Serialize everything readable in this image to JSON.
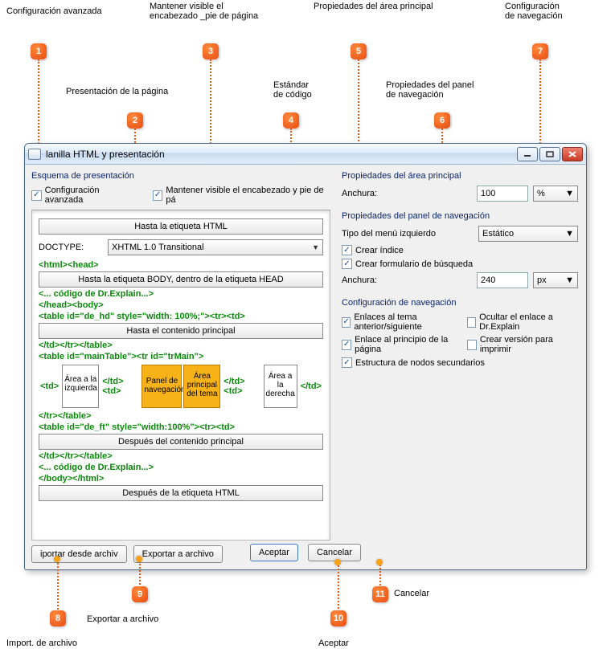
{
  "callouts": {
    "c1": {
      "num": "1",
      "label": "Configuración avanzada"
    },
    "c2": {
      "num": "2",
      "label": "Presentación de la página"
    },
    "c3": {
      "num": "3",
      "label": "Mantener visible el\nencabezado _pie de página"
    },
    "c4": {
      "num": "4",
      "label": "Estándar\nde código"
    },
    "c5": {
      "num": "5",
      "label": "Propiedades del área\nprincipal"
    },
    "c6": {
      "num": "6",
      "label": "Propiedades del panel\nde navegación"
    },
    "c7": {
      "num": "7",
      "label": "Configuración\nde navegación"
    },
    "c8": {
      "num": "8",
      "label": "Import. de archivo"
    },
    "c9": {
      "num": "9",
      "label": "Exportar a archivo"
    },
    "c10": {
      "num": "10",
      "label": "Aceptar"
    },
    "c11": {
      "num": "11",
      "label": "Cancelar"
    }
  },
  "window": {
    "title": "lanilla HTML y presentación"
  },
  "left": {
    "section_title": "Esquema de presentación",
    "chk_advanced": "Configuración avanzada",
    "chk_keep_header": "Mantener visible el encabezado y pie de pá",
    "slot_before_html": "Hasta la etiqueta HTML",
    "doctype_label": "DOCTYPE:",
    "doctype_value": "XHTML 1.0 Transitional",
    "code_html_head": "<html><head>",
    "slot_in_head": "Hasta la etiqueta BODY, dentro de la etiqueta HEAD",
    "code_dr_head": "<... código de Dr.Explain...>",
    "code_head_body": "</head><body>",
    "code_table_hd": "<table id=\"de_hd\" style=\"width: 100%;\"><tr><td>",
    "slot_before_main": "Hasta el contenido principal",
    "code_close_hd": "</td></tr></table>",
    "code_main_table": "<table id=\"mainTable\"><tr id=\"trMain\">",
    "cell_left": "Área a la\nizquierda",
    "cell_nav": "Panel de\nnavegación",
    "cell_main": "Área\nprincipal\ndel tema",
    "cell_right": "Área a\nla\nderecha",
    "tag_td_open": "<td>",
    "tag_td_close": "</td>",
    "tag_tdtd": "</td><td>",
    "code_close_main": "</tr></table>",
    "code_table_ft": "<table id=\"de_ft\" style=\"width:100%\"><tr><td>",
    "slot_after_main": "Después del contenido principal",
    "code_close_ft": "</td></tr></table>",
    "code_dr_foot": "<... código de Dr.Explain...>",
    "code_body_html": "</body></html>",
    "slot_after_html": "Después de la etiqueta HTML",
    "btn_import": "iportar desde archiv",
    "btn_export": "Exportar a archivo"
  },
  "right": {
    "main_area_title": "Propiedades del área principal",
    "width_label": "Anchura:",
    "width_value": "100",
    "width_unit": "%",
    "nav_panel_title": "Propiedades del panel de navegación",
    "menu_type_label": "Tipo del menú izquierdo",
    "menu_type_value": "Estático",
    "chk_index": "Crear índice",
    "chk_search": "Crear formulario de búsqueda",
    "nav_width_label": "Anchura:",
    "nav_width_value": "240",
    "nav_width_unit": "px",
    "nav_config_title": "Configuración de navegación",
    "chk_prevnext": "Enlaces al tema anterior/siguiente",
    "chk_hide_dr": "Ocultar el enlace a Dr.Explain",
    "chk_top": "Enlace al principio de la página",
    "chk_print": "Crear versión para imprimir",
    "chk_subnodes": "Estructura de nodos secundarios"
  },
  "footer": {
    "ok": "Aceptar",
    "cancel": "Cancelar"
  }
}
